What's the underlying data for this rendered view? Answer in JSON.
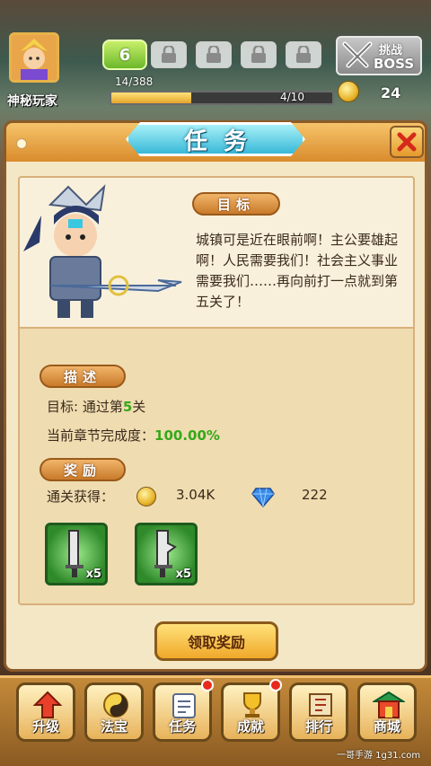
{
  "player": {
    "name": "神秘玩家"
  },
  "level": {
    "value": "6"
  },
  "progress": {
    "current_text": "14/388",
    "stage_text": "4/10",
    "fraction": 0.36
  },
  "boss_button": {
    "top": "挑战",
    "bottom": "BOSS"
  },
  "currency": {
    "coins": "24"
  },
  "panel": {
    "title": "任务"
  },
  "objective": {
    "label": "目标",
    "story": "城镇可是近在眼前啊！主公要雄起啊！人民需要我们！社会主义事业需要我们……再向前打一点就到第五关了！"
  },
  "description": {
    "label": "描述",
    "target_prefix": "目标: 通过第",
    "target_number": "5",
    "target_suffix": "关",
    "completion_label": "当前章节完成度：",
    "completion_value": "100.00%"
  },
  "rewards": {
    "label": "奖励",
    "clear_label": "通关获得：",
    "gold": "3.04K",
    "gems": "222",
    "items": [
      {
        "icon": "sword-icon",
        "qty": "x5"
      },
      {
        "icon": "blade-icon",
        "qty": "x5"
      }
    ]
  },
  "claim_button": {
    "label": "领取奖励"
  },
  "bottom_nav": [
    {
      "label": "升级",
      "icon": "upgrade-icon",
      "badge": false
    },
    {
      "label": "法宝",
      "icon": "treasure-icon",
      "badge": false
    },
    {
      "label": "任务",
      "icon": "quest-icon",
      "badge": true
    },
    {
      "label": "成就",
      "icon": "trophy-icon",
      "badge": true
    },
    {
      "label": "排行",
      "icon": "ranking-icon",
      "badge": false
    },
    {
      "label": "商城",
      "icon": "shop-icon",
      "badge": false
    }
  ],
  "watermark": {
    "text": "一哥手游 1g31.com"
  },
  "colors": {
    "accent": "#35a81a",
    "panel_bg": "#f3e7c5",
    "title_ribbon": "#38b9d8"
  }
}
